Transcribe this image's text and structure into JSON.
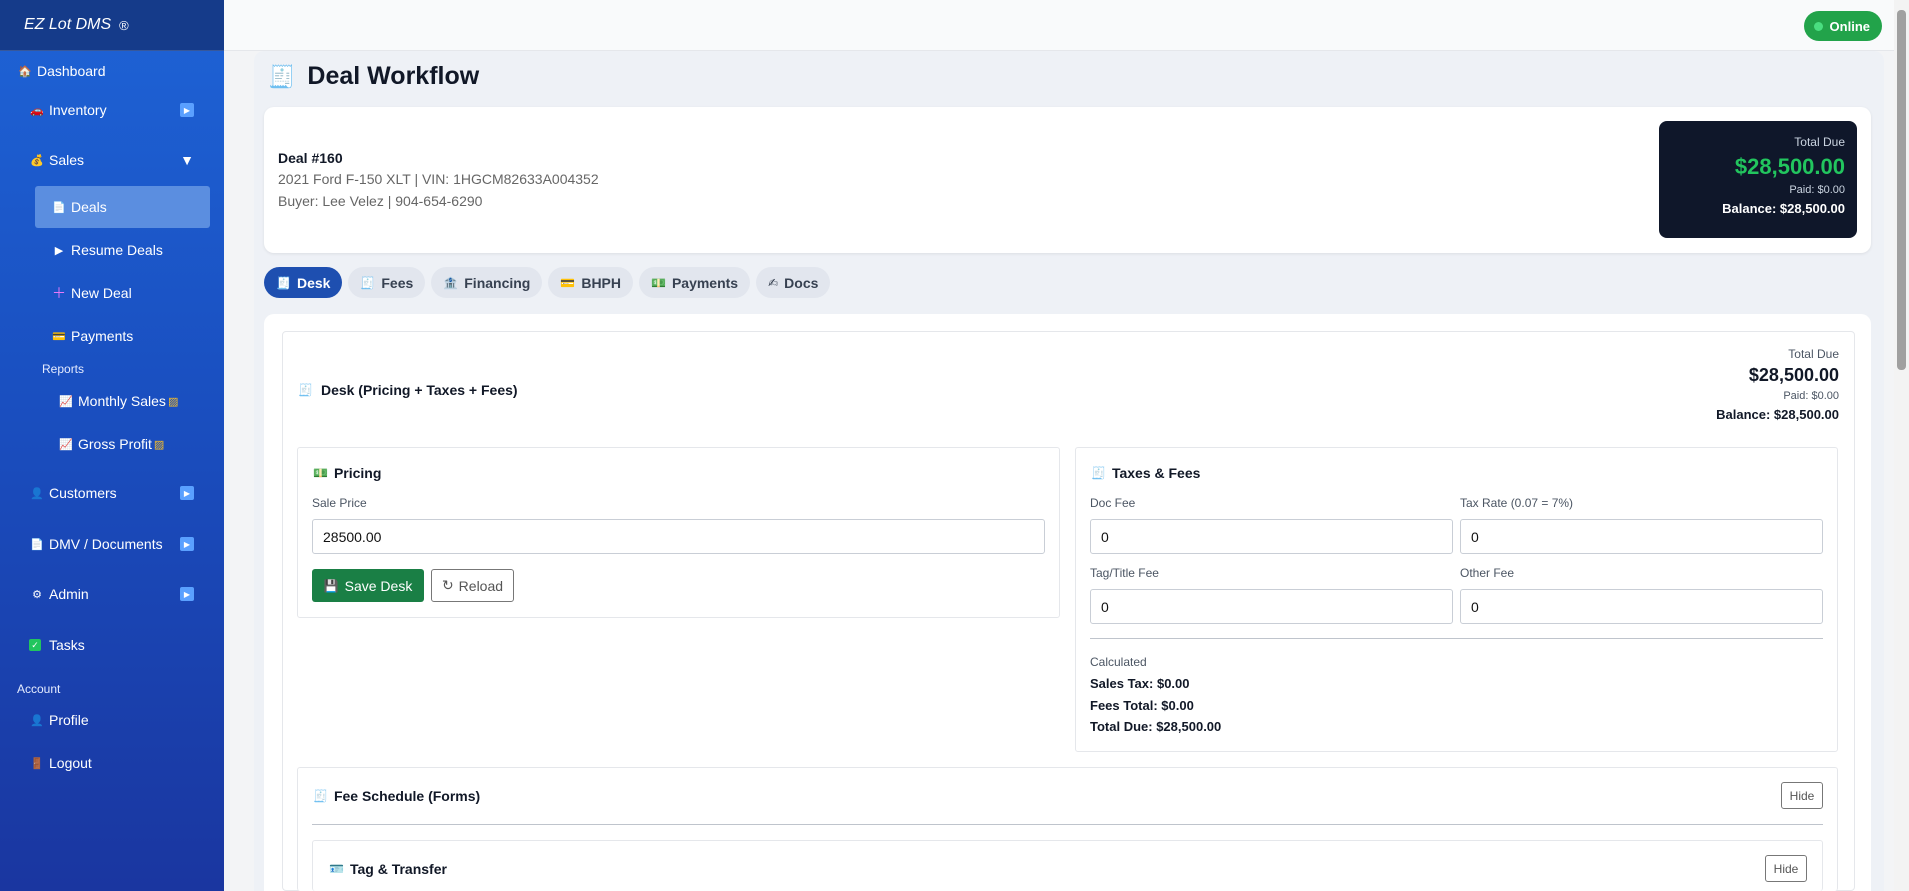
{
  "app": {
    "brand": "EZ Lot DMS",
    "brand_mark": "®"
  },
  "sidebar": {
    "dashboard": "Dashboard",
    "inventory": "Inventory",
    "sales": "Sales",
    "deals": "Deals",
    "resume_deals": "Resume Deals",
    "new_deal": "New Deal",
    "payments": "Payments",
    "reports_label": "Reports",
    "monthly_sales": "Monthly Sales",
    "gross_profit": "Gross Profit",
    "customers": "Customers",
    "dmv": "DMV / Documents",
    "admin": "Admin",
    "tasks": "Tasks",
    "account_label": "Account",
    "profile": "Profile",
    "logout": "Logout"
  },
  "status": {
    "label": "Online"
  },
  "page": {
    "title": "Deal Workflow"
  },
  "deal": {
    "number": "Deal #160",
    "vehicle": "2021 Ford F-150 XLT | VIN: 1HGCM82633A004352",
    "buyer": "Buyer: Lee Velez | 904-654-6290",
    "total_due_label": "Total Due",
    "total_due": "$28,500.00",
    "paid": "Paid: $0.00",
    "balance": "Balance: $28,500.00"
  },
  "tabs": [
    "Desk",
    "Fees",
    "Financing",
    "BHPH",
    "Payments",
    "Docs"
  ],
  "desk": {
    "heading": "Desk (Pricing + Taxes + Fees)",
    "total_due_label": "Total Due",
    "total_due": "$28,500.00",
    "paid": "Paid: $0.00",
    "balance": "Balance: $28,500.00",
    "pricing": {
      "title": "Pricing",
      "sale_price_label": "Sale Price",
      "sale_price": "28500.00",
      "save_label": "Save Desk",
      "reload_label": "Reload"
    },
    "taxes": {
      "title": "Taxes & Fees",
      "doc_fee_label": "Doc Fee",
      "doc_fee": "0",
      "tax_rate_label": "Tax Rate (0.07 = 7%)",
      "tax_rate": "0",
      "tag_fee_label": "Tag/Title Fee",
      "tag_fee": "0",
      "other_fee_label": "Other Fee",
      "other_fee": "0",
      "calculated_label": "Calculated",
      "sales_tax": "Sales Tax: $0.00",
      "fees_total": "Fees Total: $0.00",
      "total_due": "Total Due: $28,500.00"
    },
    "fee_schedule": {
      "title": "Fee Schedule (Forms)",
      "hide_label": "Hide"
    },
    "tag_transfer": {
      "title": "Tag & Transfer",
      "hide_label": "Hide"
    }
  },
  "colors": {
    "sidebar": "#1e63d6",
    "accent": "#1e4fb0",
    "success": "#22a34a",
    "dark": "#0f172a"
  }
}
